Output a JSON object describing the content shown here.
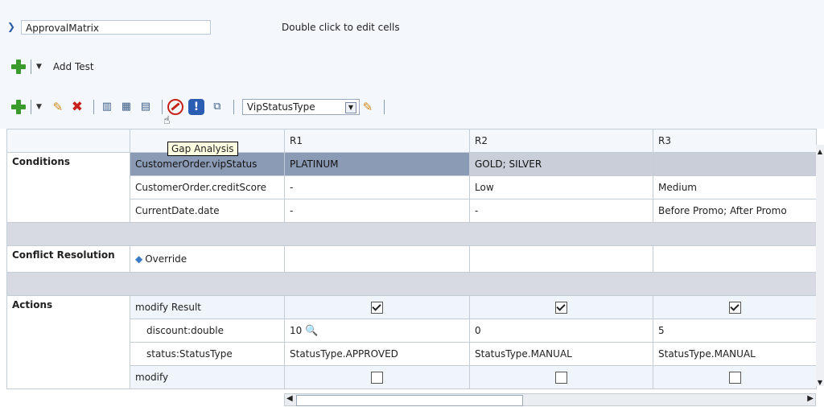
{
  "header": {
    "name_value": "ApprovalMatrix",
    "hint": "Double click to edit cells",
    "add_test_label": "Add Test"
  },
  "toolbar": {
    "select_value": "VipStatusType",
    "tooltip": "Gap Analysis"
  },
  "table": {
    "columns": [
      "R1",
      "R2",
      "R3"
    ],
    "sections": {
      "conditions": "Conditions",
      "conflict": "Conflict Resolution",
      "actions": "Actions"
    },
    "conditions": [
      {
        "label": "CustomerOrder.vipStatus",
        "r1": "PLATINUM",
        "r2": "GOLD; SILVER",
        "r3": ""
      },
      {
        "label": "CustomerOrder.creditScore",
        "r1": "-",
        "r2": "Low",
        "r3": "Medium"
      },
      {
        "label": "CurrentDate.date",
        "r1": "-",
        "r2": "-",
        "r3": "Before Promo; After Promo"
      }
    ],
    "override_label": "Override",
    "actions": [
      {
        "label": "modify Result",
        "checked": [
          true,
          true,
          true
        ]
      },
      {
        "label": "discount:double",
        "r1": "10",
        "r2": "0",
        "r3": "5"
      },
      {
        "label": "status:StatusType",
        "r1": "StatusType.APPROVED",
        "r2": "StatusType.MANUAL",
        "r3": "StatusType.MANUAL"
      },
      {
        "label": "modify",
        "checked": [
          false,
          false,
          false
        ]
      }
    ]
  }
}
